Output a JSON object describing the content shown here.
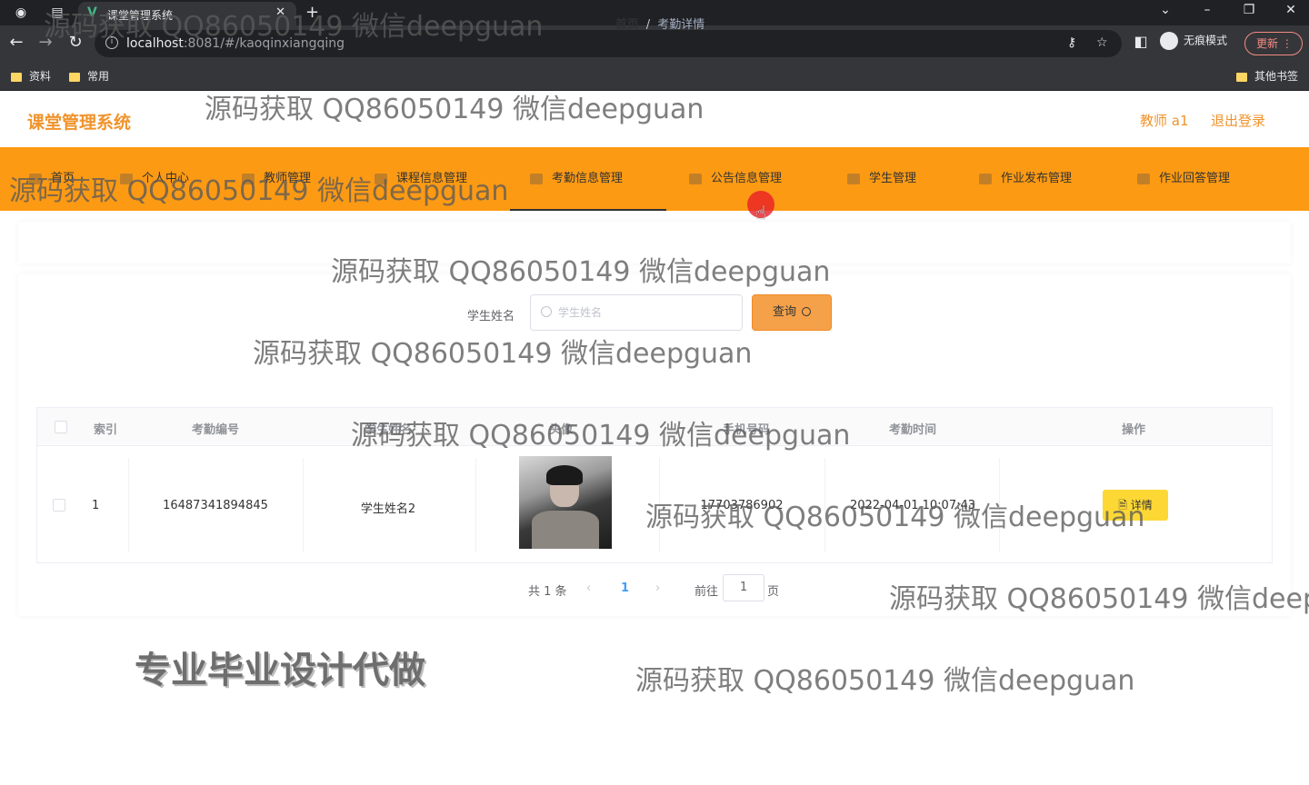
{
  "browser": {
    "tab_title": "课堂管理系统",
    "url_host": "localhost",
    "url_path": ":8081/#/kaoqinxiangqing",
    "incognito_label": "无痕模式",
    "update_label": "更新",
    "bookmarks": [
      "资料",
      "常用"
    ],
    "other_bookmarks": "其他书签"
  },
  "header": {
    "title": "课堂管理系统",
    "user": "教师 a1",
    "logout": "退出登录"
  },
  "menu": {
    "items": [
      "首页",
      "个人中心",
      "教师管理",
      "课程信息管理",
      "考勤信息管理",
      "公告信息管理",
      "学生管理",
      "作业发布管理",
      "作业回答管理"
    ],
    "active": "考勤信息管理"
  },
  "breadcrumb": {
    "home": "首页",
    "separator": "/",
    "current": "考勤详情"
  },
  "search": {
    "label": "学生姓名",
    "placeholder": "学生姓名",
    "button": "查询"
  },
  "table": {
    "columns": [
      "索引",
      "考勤编号",
      "学生姓名",
      "头像",
      "手机号码",
      "考勤时间",
      "操作"
    ],
    "rows": [
      {
        "index": "1",
        "attendance_no": "16487341894845",
        "student_name": "学生姓名2",
        "phone": "17703786902",
        "time": "2022-04-01 10:07:43",
        "action": "详情"
      }
    ]
  },
  "pagination": {
    "total": "共 1 条",
    "prev": "‹",
    "current": "1",
    "next": "›",
    "goto": "前往",
    "page_input": "1",
    "page_unit": "页"
  },
  "watermark": {
    "text": "源码获取 QQ86050149 微信deepguan",
    "big_text": "专业毕业设计代做"
  },
  "colors": {
    "menu_bg": "#fd9a13",
    "brand": "#f0932b",
    "detail_button": "#fdd835"
  }
}
